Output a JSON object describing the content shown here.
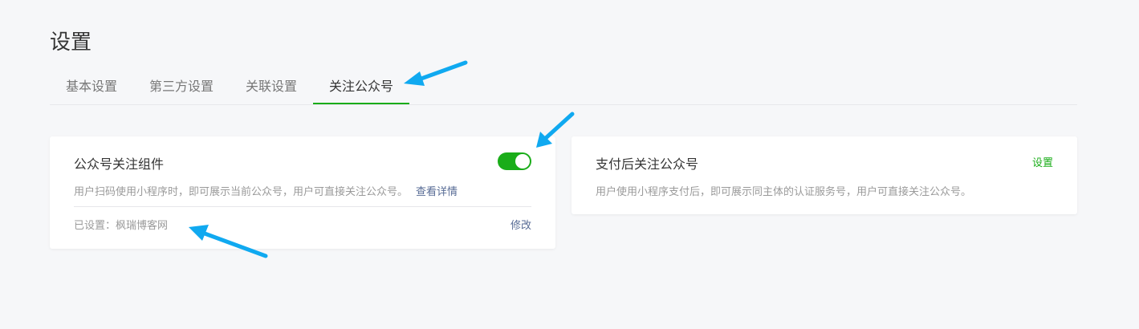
{
  "page": {
    "title": "设置"
  },
  "tabs": [
    {
      "label": "基本设置",
      "active": false
    },
    {
      "label": "第三方设置",
      "active": false
    },
    {
      "label": "关联设置",
      "active": false
    },
    {
      "label": "关注公众号",
      "active": true
    }
  ],
  "cards": {
    "follow_widget": {
      "title": "公众号关注组件",
      "description": "用户扫码使用小程序时，即可展示当前公众号，用户可直接关注公众号。",
      "detail_link": "查看详情",
      "toggle_on": true,
      "setting_text": "已设置：枫瑞博客网",
      "modify_label": "修改"
    },
    "after_payment": {
      "title": "支付后关注公众号",
      "description": "用户使用小程序支付后，即可展示同主体的认证服务号，用户可直接关注公众号。",
      "set_label": "设置"
    }
  },
  "colors": {
    "accent_green": "#1aad19",
    "link_blue": "#576b95",
    "annotation_arrow": "#10a9f0"
  }
}
